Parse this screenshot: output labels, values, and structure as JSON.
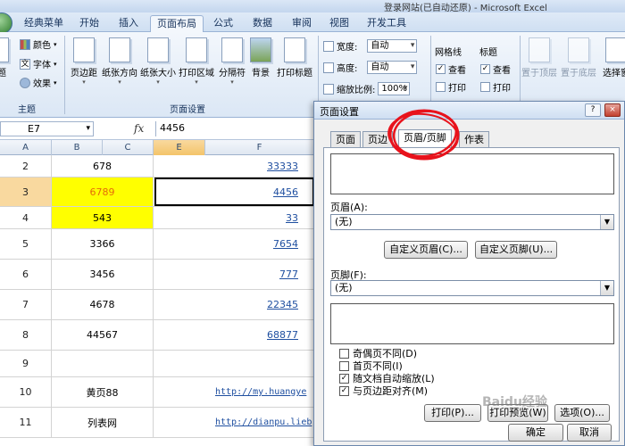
{
  "window": {
    "title": "登录网站(已自动还原) - Microsoft Excel"
  },
  "tabs": [
    {
      "label": "经典菜单",
      "active": false
    },
    {
      "label": "开始",
      "active": false
    },
    {
      "label": "插入",
      "active": false
    },
    {
      "label": "页面布局",
      "active": true
    },
    {
      "label": "公式",
      "active": false
    },
    {
      "label": "数据",
      "active": false
    },
    {
      "label": "审阅",
      "active": false
    },
    {
      "label": "视图",
      "active": false
    },
    {
      "label": "开发工具",
      "active": false
    }
  ],
  "ribbon": {
    "theme_group": {
      "label": "主题",
      "big_label": "题",
      "colors": "颜色",
      "fonts": "字体",
      "effects": "效果"
    },
    "page_setup_group": {
      "label": "页面设置",
      "buttons": [
        "页边距",
        "纸张方向",
        "纸张大小",
        "打印区域",
        "分隔符",
        "背景",
        "打印标题"
      ]
    },
    "scale_group": {
      "width_label": "宽度:",
      "width_value": "自动",
      "height_label": "高度:",
      "height_value": "自动",
      "scale_label": "缩放比例:",
      "scale_value": "100%"
    },
    "sheet_options": {
      "gridlines": "网格线",
      "headings": "标题",
      "view": "查看",
      "print": "打印"
    },
    "arrange": [
      "置于顶层",
      "置于底层",
      "选择窗"
    ]
  },
  "formula_bar": {
    "name_box": "E7",
    "fx": "fx",
    "value": "4456"
  },
  "sheet": {
    "columns": [
      "A",
      "B",
      "C",
      "E",
      "F"
    ],
    "rows": [
      {
        "num": "2",
        "b": "678",
        "f": "33333",
        "link": "number"
      },
      {
        "num": "3",
        "b": "6789",
        "f": "4456",
        "link": "number"
      },
      {
        "num": "4",
        "b": "543",
        "f": "33",
        "link": "number"
      },
      {
        "num": "5",
        "b": "3366",
        "f": "7654",
        "link": "number"
      },
      {
        "num": "6",
        "b": "3456",
        "f": "777",
        "link": "number"
      },
      {
        "num": "7",
        "b": "4678",
        "f": "22345",
        "link": "number"
      },
      {
        "num": "8",
        "b": "44567",
        "f": "68877",
        "link": "number"
      },
      {
        "num": "9",
        "b": "",
        "f": "",
        "link": "none"
      },
      {
        "num": "10",
        "b": "黄页88",
        "f": "http://my.huangye",
        "link": "url"
      },
      {
        "num": "11",
        "b": "列表网",
        "f": "http://dianpu.lieb",
        "link": "url"
      }
    ],
    "colors": {
      "yellow": "#ffff00",
      "selected_value": "#e46c0a",
      "link": "#1f4fa0"
    }
  },
  "dialog": {
    "title": "页面设置",
    "help": "?",
    "close": "×",
    "tabs": [
      {
        "label": "页面",
        "active": false
      },
      {
        "label": "页边",
        "active": false
      },
      {
        "label": "页眉/页脚",
        "active": true
      },
      {
        "label": "作表",
        "active": false
      }
    ],
    "header_label": "页眉(A):",
    "header_value": "(无)",
    "custom_header": "自定义页眉(C)...",
    "custom_footer": "自定义页脚(U)...",
    "footer_label": "页脚(F):",
    "footer_value": "(无)",
    "checks": [
      {
        "label": "奇偶页不同(D)",
        "checked": false
      },
      {
        "label": "首页不同(I)",
        "checked": false
      },
      {
        "label": "随文档自动缩放(L)",
        "checked": true
      },
      {
        "label": "与页边距对齐(M)",
        "checked": true
      }
    ],
    "buttons": {
      "print": "打印(P)...",
      "print_preview": "打印预览(W)",
      "options": "选项(O)...",
      "ok": "确定",
      "cancel": "取消"
    },
    "annotation_color": "#e8131c"
  },
  "watermark": "Baidu经验"
}
